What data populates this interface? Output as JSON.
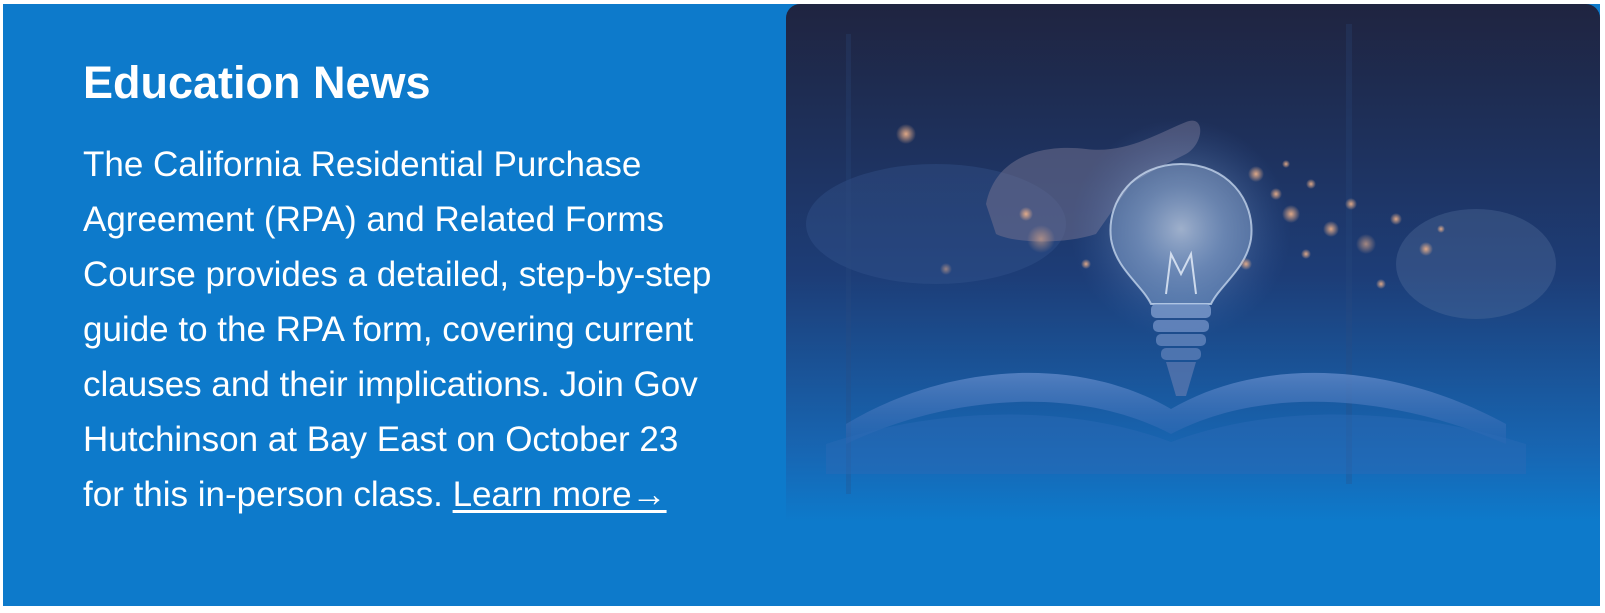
{
  "section": {
    "title": "Education News",
    "body": "The California Residential Purchase Agreement (RPA) and Related Forms Course provides a detailed, step-by-step guide to the RPA form, covering current clauses and their implications. Join Gov Hutchinson at Bay East on October 23 for this in-person class. ",
    "link_label": "Learn more→"
  },
  "colors": {
    "background": "#0d7acb",
    "text": "#ffffff",
    "image_dark": "#1f2440"
  },
  "image": {
    "icon": "lightbulb-over-open-book-icon"
  }
}
